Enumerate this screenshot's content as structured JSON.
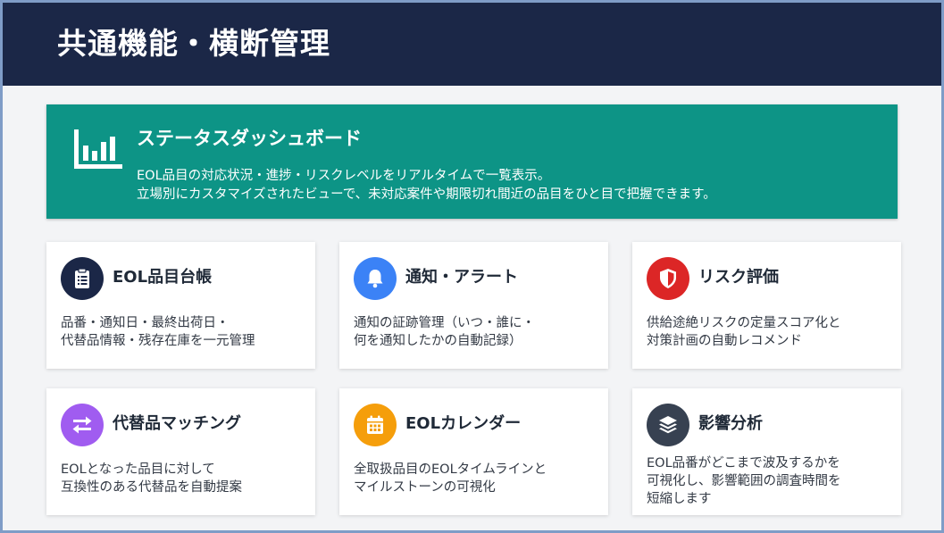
{
  "header": {
    "title": "共通機能・横断管理"
  },
  "banner": {
    "icon": "bar-chart-icon",
    "title": "ステータスダッシュボード",
    "desc_lines": [
      "EOL品目の対応状況・進捗・リスクレベルをリアルタイムで一覧表示。",
      "立場別にカスタマイズされたビューで、未対応案件や期限切れ間近の品目をひと目で把握できます。"
    ]
  },
  "cards": [
    {
      "icon": "clipboard-icon",
      "color": "#1b2747",
      "title": "EOL品目台帳",
      "desc_lines": [
        "品番・通知日・最終出荷日・",
        "代替品情報・残存在庫を一元管理"
      ]
    },
    {
      "icon": "bell-icon",
      "color": "#3b82f6",
      "title": "通知・アラート",
      "desc_lines": [
        "通知の証跡管理（いつ・誰に・",
        "何を通知したかの自動記録）"
      ]
    },
    {
      "icon": "shield-icon",
      "color": "#dc2626",
      "title": "リスク評価",
      "desc_lines": [
        "供給途絶リスクの定量スコア化と",
        "対策計画の自動レコメンド"
      ]
    },
    {
      "icon": "swap-arrows-icon",
      "color": "#a05cf0",
      "title": "代替品マッチング",
      "desc_lines": [
        "EOLとなった品目に対して",
        "互換性のある代替品を自動提案"
      ]
    },
    {
      "icon": "calendar-icon",
      "color": "#f59e0b",
      "title": "EOLカレンダー",
      "desc_lines": [
        "全取扱品目のEOLタイムラインと",
        "マイルストーンの可視化"
      ]
    },
    {
      "icon": "layers-icon",
      "color": "#374151",
      "title": "影響分析",
      "desc_lines": [
        "EOL品番がどこまで波及するかを",
        "可視化し、影響範囲の調査時間を",
        "短縮します"
      ]
    }
  ]
}
